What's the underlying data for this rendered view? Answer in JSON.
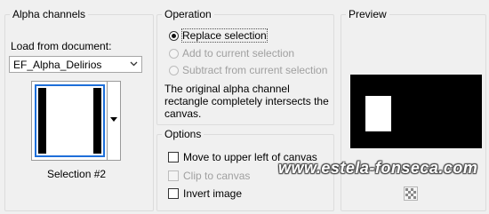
{
  "alpha": {
    "title": "Alpha channels",
    "load_label": "Load from document:",
    "document_value": "EF_Alpha_Delirios",
    "selection_label": "Selection #2"
  },
  "operation": {
    "title": "Operation",
    "options": [
      {
        "label": "Replace selection",
        "checked": true,
        "enabled": true
      },
      {
        "label": "Add to current selection",
        "checked": false,
        "enabled": false
      },
      {
        "label": "Subtract from current selection",
        "checked": false,
        "enabled": false
      }
    ],
    "info": "The original alpha channel rectangle completely intersects the canvas."
  },
  "options": {
    "title": "Options",
    "items": [
      {
        "label": "Move to upper left of canvas",
        "checked": false,
        "enabled": true
      },
      {
        "label": "Clip to canvas",
        "checked": false,
        "enabled": false
      },
      {
        "label": "Invert image",
        "checked": false,
        "enabled": true
      }
    ]
  },
  "preview": {
    "title": "Preview"
  },
  "watermark": "www.estela-fonseca.com",
  "colors": {
    "thumbnail_border": "#1e6fd9",
    "preview_bg": "#000000"
  }
}
